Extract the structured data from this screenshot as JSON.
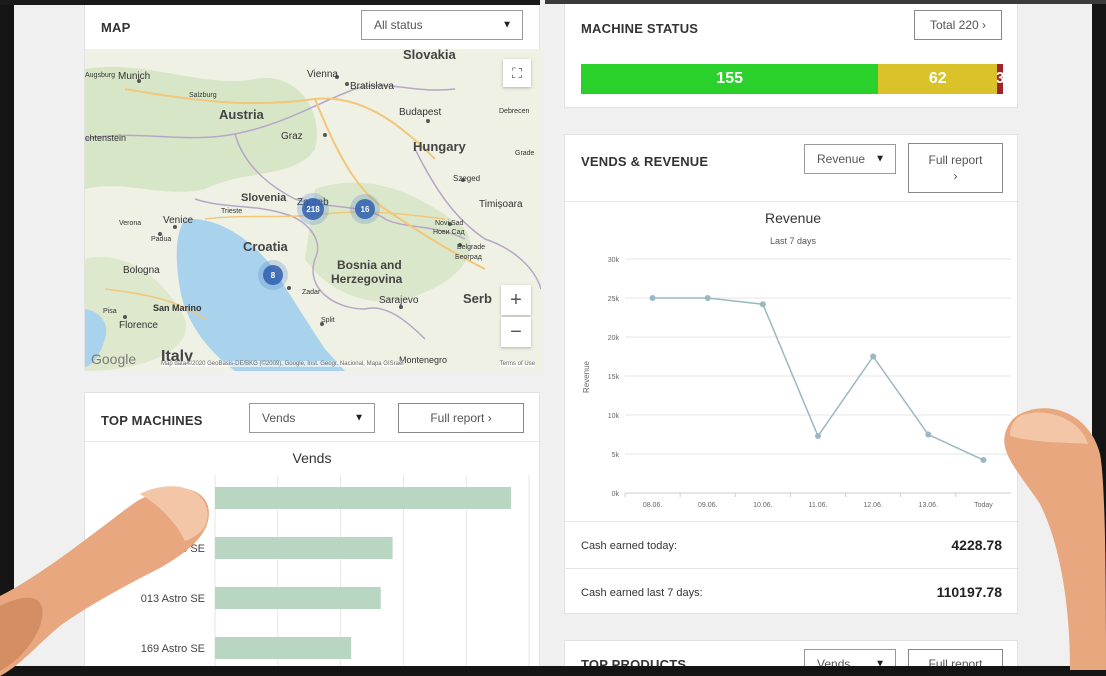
{
  "map": {
    "title": "MAP",
    "status_select": "All status",
    "zoom_in": "+",
    "zoom_out": "−",
    "fullscreen_icon": "fullscreen-icon",
    "clusters": [
      "218",
      "16",
      "8"
    ],
    "places": [
      "Slovakia",
      "Munich",
      "Vienna",
      "Bratislava",
      "Augsburg",
      "Salzburg",
      "Austria",
      "Budapest",
      "Debrecen",
      "chtenstein",
      "Graz",
      "Hungary",
      "Grade",
      "Szeged",
      "Slovenia",
      "Zagreb",
      "Trieste",
      "Timișoara",
      "Verona",
      "Venice",
      "Padua",
      "Novi Sad",
      "Нови Сад",
      "Croatia",
      "Belgrade",
      "Београд",
      "Bologna",
      "Zadar",
      "Bosnia and",
      "Herzegovina",
      "Sarajevo",
      "Serb",
      "San Marino",
      "Pisa",
      "Florence",
      "Split",
      "Italy",
      "Montenegro"
    ],
    "google_logo": "Google",
    "attribution": "Map data ©2020 GeoBasis-DE/BKG (©2009), Google, Inst. Geogr. Nacional, Mapa GISrael",
    "terms": "Terms of Use"
  },
  "machine_status": {
    "title": "MACHINE STATUS",
    "total_button": "Total 220",
    "segments": [
      {
        "value": 155,
        "label": "155",
        "color": "#2ad12a"
      },
      {
        "value": 62,
        "label": "62",
        "color": "#d9c22a"
      },
      {
        "value": 3,
        "label": "3",
        "color": "#a0242a"
      }
    ]
  },
  "vends_revenue": {
    "title": "VENDS & REVENUE",
    "metric_select": "Revenue",
    "full_report": "Full report",
    "cash_today_label": "Cash earned today:",
    "cash_today_value": "4228.78",
    "cash_7d_label": "Cash earned last 7 days:",
    "cash_7d_value": "110197.78"
  },
  "top_machines": {
    "title": "TOP MACHINES",
    "metric_select": "Vends",
    "full_report": "Full report",
    "rows": [
      "tro SE",
      "013 Astro SE",
      "169 Astro SE"
    ]
  },
  "top_products": {
    "title": "TOP PRODUCTS",
    "metric_select": "Vends",
    "full_report": "Full report"
  },
  "chart_data": [
    {
      "type": "line",
      "title": "Revenue",
      "subtitle": "Last 7 days",
      "xlabel": "",
      "ylabel": "Revenue",
      "categories": [
        "08.06.",
        "09.06.",
        "10.06.",
        "11.06.",
        "12.06.",
        "13.06.",
        "Today"
      ],
      "values": [
        25000,
        25000,
        24200,
        7300,
        17500,
        7500,
        4228.78
      ],
      "ylim": [
        0,
        30000
      ],
      "yticks": [
        "0k",
        "5k",
        "10k",
        "15k",
        "20k",
        "25k",
        "30k"
      ],
      "grid": true,
      "color": "#9ab8c4"
    },
    {
      "type": "bar",
      "orientation": "horizontal",
      "title": "Vends",
      "categories": [
        "",
        "tro SE",
        "013 Astro SE",
        "169 Astro SE"
      ],
      "values": [
        100,
        60,
        56,
        46
      ],
      "color": "#b9d6c3",
      "grid": true
    }
  ]
}
